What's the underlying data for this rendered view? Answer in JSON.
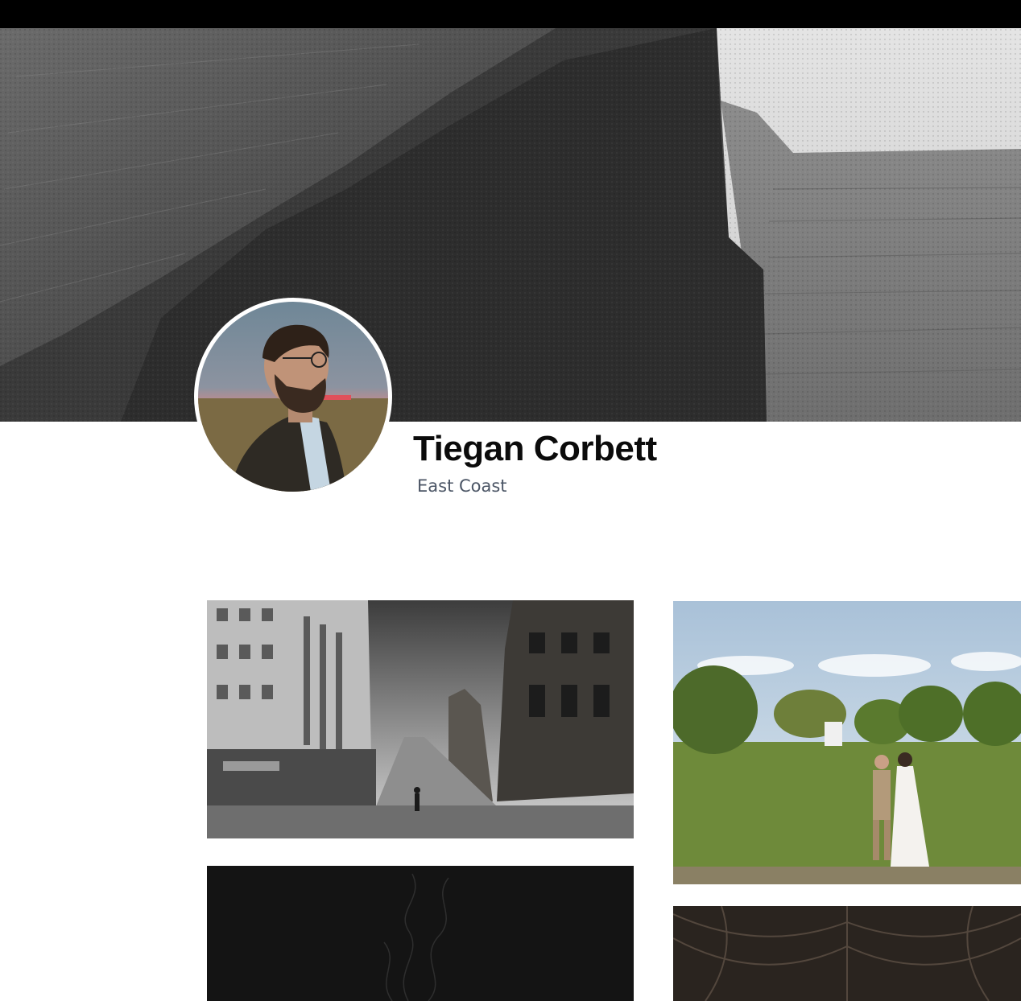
{
  "profile": {
    "name": "Tiegan Corbett",
    "location": "East Coast",
    "avatar_icon": "profile-portrait",
    "cover_icon": "cliff-landscape-photo"
  },
  "gallery": {
    "photos": [
      {
        "icon": "city-street-photo"
      },
      {
        "icon": "wedding-couple-photo"
      },
      {
        "icon": "smoke-photo"
      },
      {
        "icon": "cathedral-ceiling-photo"
      }
    ]
  },
  "colors": {
    "top_bar": "#000000",
    "name_text": "#0b0b0b",
    "location_text": "#4b5565",
    "background": "#ffffff"
  }
}
